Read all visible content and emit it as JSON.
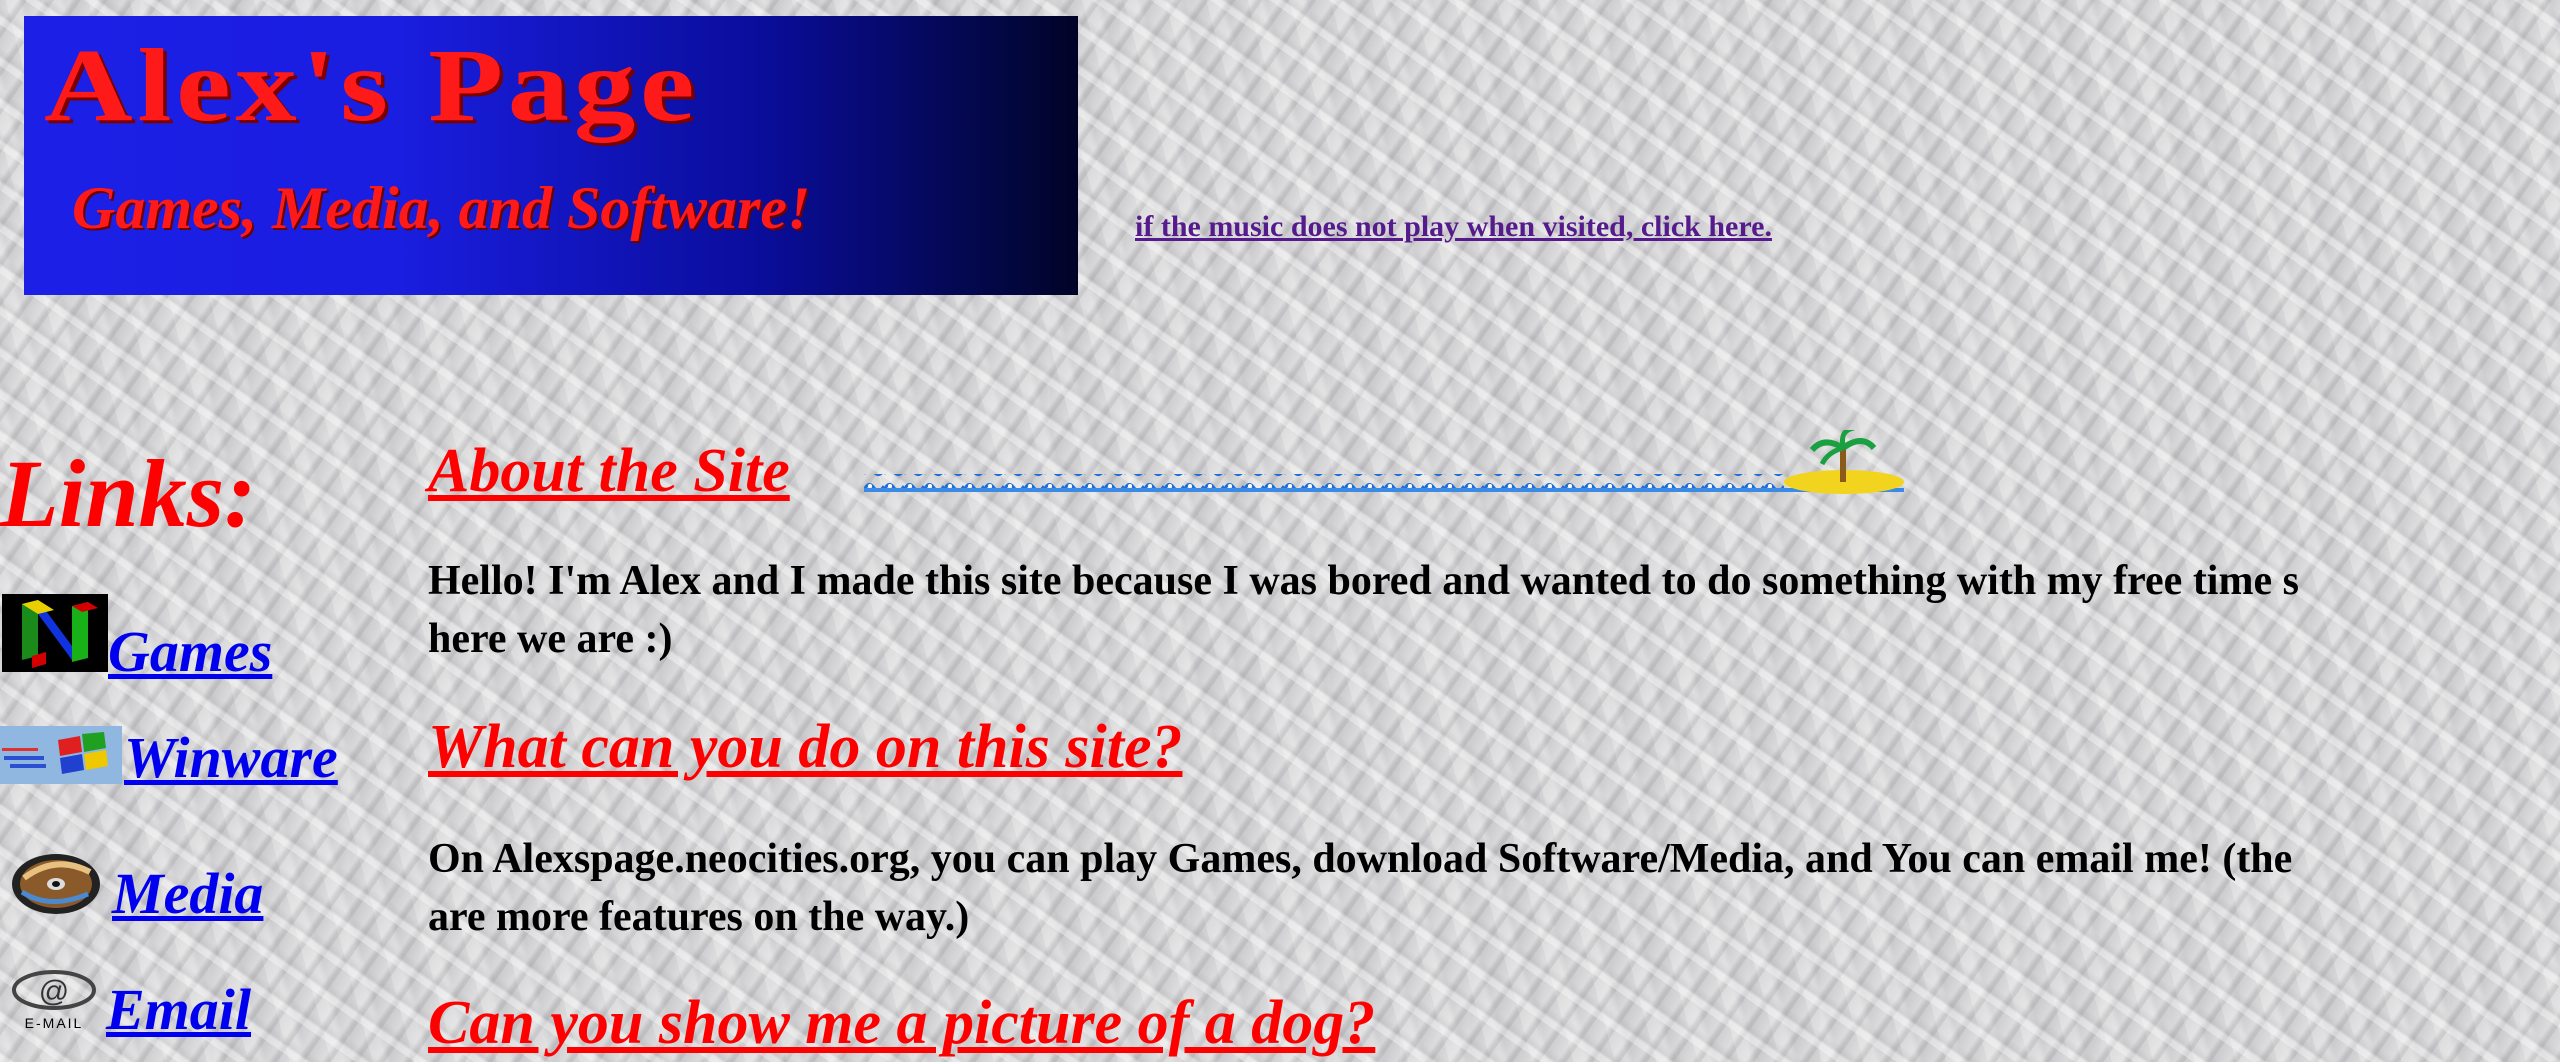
{
  "banner": {
    "title": "Alex's Page",
    "subtitle": "Games, Media, and Software!"
  },
  "music_link": "if the music does not play when visited, click here.",
  "sidebar": {
    "heading": "Links:",
    "items": [
      {
        "label": "Games",
        "icon": "n64-logo-icon"
      },
      {
        "label": "Winware",
        "icon": "windows-flag-icon"
      },
      {
        "label": "Media",
        "icon": "cd-disc-icon"
      },
      {
        "label": "Email",
        "icon": "email-at-icon"
      }
    ]
  },
  "main": {
    "sections": [
      {
        "heading": "About the Site",
        "lines": [
          "Hello! I'm Alex and I made this site because I was bored and wanted to do something with my free time s",
          "here we are :)"
        ]
      },
      {
        "heading": "What can you do on this site?",
        "lines": [
          "On Alexspage.neocities.org, you can play Games, download Software/Media, and You can email me! (the",
          "are more features on the way.)"
        ]
      },
      {
        "heading": "Can you show me a picture of a dog?"
      }
    ],
    "decoration": "wave-island-icon"
  },
  "colors": {
    "heading_red": "#ff0000",
    "link_blue": "#0000ee",
    "visited_purple": "#551a8b",
    "banner_blue": "#1c1fe6"
  }
}
